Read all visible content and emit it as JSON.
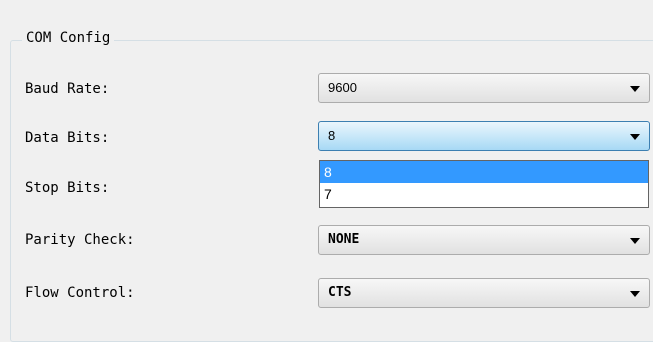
{
  "group": {
    "title": "COM Config"
  },
  "fields": [
    {
      "label": "Baud Rate:",
      "value": "9600"
    },
    {
      "label": "Data Bits:",
      "value": "8"
    },
    {
      "label": "Stop Bits:",
      "value": ""
    },
    {
      "label": "Parity Check:",
      "value": "NONE"
    },
    {
      "label": "Flow Control:",
      "value": "CTS"
    }
  ],
  "dropdown": {
    "options": [
      "8",
      "7"
    ],
    "selected": "8"
  },
  "icons": {
    "dropdown_arrow": "chevron-down-icon"
  },
  "colors": {
    "selection": "#3399ff",
    "active_border": "#3c7fb1"
  }
}
